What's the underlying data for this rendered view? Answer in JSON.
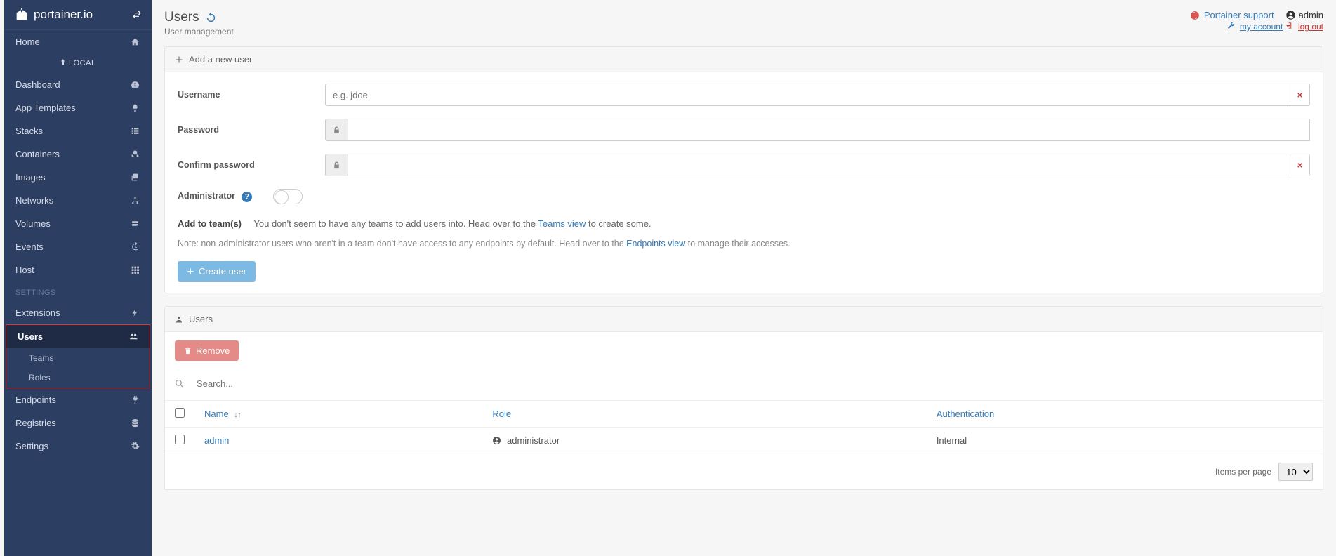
{
  "brand": "portainer.io",
  "sidebar": {
    "local_label": "LOCAL",
    "items": [
      {
        "label": "Home",
        "icon": "home"
      },
      {
        "label": "Dashboard",
        "icon": "tachometer"
      },
      {
        "label": "App Templates",
        "icon": "rocket"
      },
      {
        "label": "Stacks",
        "icon": "list"
      },
      {
        "label": "Containers",
        "icon": "cubes"
      },
      {
        "label": "Images",
        "icon": "clone"
      },
      {
        "label": "Networks",
        "icon": "sitemap"
      },
      {
        "label": "Volumes",
        "icon": "hdd"
      },
      {
        "label": "Events",
        "icon": "history"
      },
      {
        "label": "Host",
        "icon": "th"
      }
    ],
    "settings_label": "SETTINGS",
    "settings_items": [
      {
        "label": "Extensions",
        "icon": "bolt"
      },
      {
        "label": "Users",
        "icon": "users",
        "active": true,
        "children": [
          {
            "label": "Teams"
          },
          {
            "label": "Roles"
          }
        ]
      },
      {
        "label": "Endpoints",
        "icon": "plug"
      },
      {
        "label": "Registries",
        "icon": "database"
      },
      {
        "label": "Settings",
        "icon": "cogs"
      }
    ]
  },
  "page": {
    "title": "Users",
    "subtitle": "User management"
  },
  "header": {
    "support": "Portainer support",
    "username": "admin",
    "my_account": "my account",
    "log_out": "log out"
  },
  "form": {
    "panel_title": "Add a new user",
    "username_label": "Username",
    "username_placeholder": "e.g. jdoe",
    "password_label": "Password",
    "confirm_label": "Confirm password",
    "admin_label": "Administrator",
    "teams_label": "Add to team(s)",
    "teams_intro": "You don't seem to have any teams to add users into. Head over to the ",
    "teams_link": "Teams view",
    "teams_outro": " to create some.",
    "note_pre": "Note: non-administrator users who aren't in a team don't have access to any endpoints by default. Head over to the ",
    "note_link": "Endpoints view",
    "note_post": " to manage their accesses.",
    "create_btn": "Create user"
  },
  "list": {
    "panel_title": "Users",
    "remove_btn": "Remove",
    "search_placeholder": "Search...",
    "columns": {
      "name": "Name",
      "role": "Role",
      "auth": "Authentication"
    },
    "rows": [
      {
        "name": "admin",
        "role": "administrator",
        "auth": "Internal"
      }
    ],
    "pager_label": "Items per page",
    "pager_value": "10"
  }
}
